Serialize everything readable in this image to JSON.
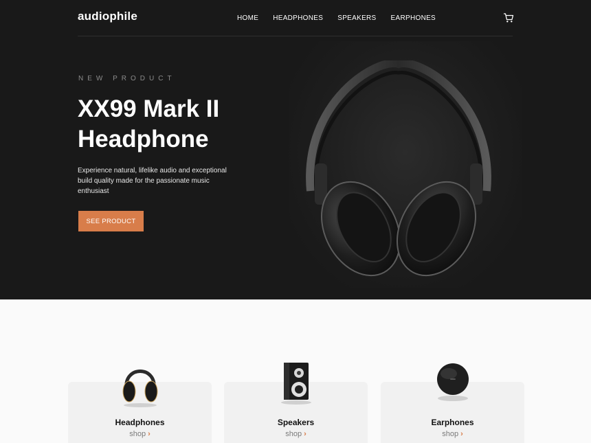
{
  "brand": {
    "logo": "audiophile",
    "accent_color": "#d87d4a"
  },
  "nav": {
    "links": [
      "HOME",
      "HEADPHONES",
      "SPEAKERS",
      "EARPHONES"
    ],
    "cart_icon": "cart-icon"
  },
  "hero": {
    "eyebrow": "NEW PRODUCT",
    "title_line1": "XX99 Mark II",
    "title_line2": "Headphone",
    "description": "Experience natural, lifelike audio and exceptional build quality made for the passionate music enthusiast",
    "cta_label": "SEE PRODUCT"
  },
  "categories": [
    {
      "name": "Headphones",
      "shop_label": "shop",
      "icon": "headphones-icon"
    },
    {
      "name": "Speakers",
      "shop_label": "shop",
      "icon": "speaker-icon"
    },
    {
      "name": "Earphones",
      "shop_label": "shop",
      "icon": "earphones-icon"
    }
  ]
}
